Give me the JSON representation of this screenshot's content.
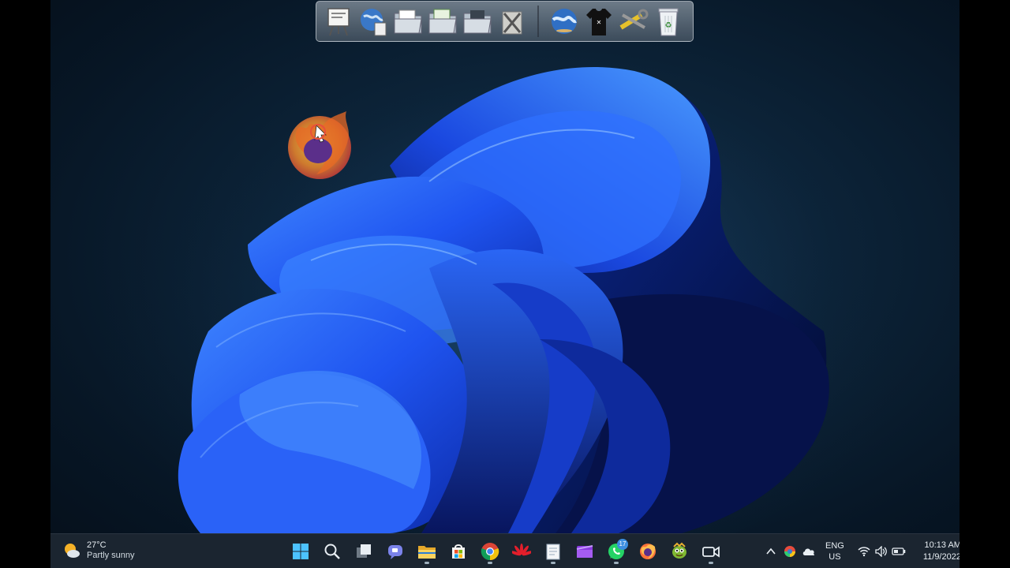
{
  "dock": {
    "items": [
      {
        "name": "presentation-board-icon"
      },
      {
        "name": "globe-document-icon"
      },
      {
        "name": "document-folder-icon"
      },
      {
        "name": "spreadsheet-folder-icon"
      },
      {
        "name": "network-folder-icon"
      },
      {
        "name": "tools-icon"
      },
      {
        "name": "globe-icon"
      },
      {
        "name": "tshirt-icon"
      },
      {
        "name": "wrench-screwdriver-icon"
      },
      {
        "name": "recycle-bin-icon"
      }
    ]
  },
  "desktop": {
    "icons": [
      {
        "name": "firefox-icon"
      }
    ]
  },
  "taskbar": {
    "weather": {
      "temperature": "27°C",
      "condition": "Partly sunny"
    },
    "apps": [
      {
        "name": "start-button",
        "icon": "windows-logo"
      },
      {
        "name": "search-button",
        "icon": "search-icon"
      },
      {
        "name": "task-view-button",
        "icon": "task-view-icon"
      },
      {
        "name": "chat-button",
        "icon": "teams-chat-icon"
      },
      {
        "name": "file-explorer-button",
        "icon": "folder-icon"
      },
      {
        "name": "microsoft-store-button",
        "icon": "store-icon"
      },
      {
        "name": "chrome-button",
        "icon": "chrome-icon"
      },
      {
        "name": "huawei-button",
        "icon": "huawei-icon"
      },
      {
        "name": "notepad-button",
        "icon": "notepad-icon"
      },
      {
        "name": "clipchamp-button",
        "icon": "video-editor-icon"
      },
      {
        "name": "whatsapp-button",
        "icon": "whatsapp-icon",
        "badge": "17"
      },
      {
        "name": "firefox-button",
        "icon": "firefox-icon"
      },
      {
        "name": "game-button",
        "icon": "game-character-icon"
      },
      {
        "name": "camera-button",
        "icon": "video-camera-icon"
      }
    ],
    "tray": {
      "language": {
        "line1": "ENG",
        "line2": "US"
      },
      "clock": {
        "time": "10:13 AM",
        "date": "11/9/2022"
      }
    }
  },
  "colors": {
    "taskbar_bg": "#1b2530",
    "accent_blue": "#2a5ef0",
    "desktop_bg": "#0c2338"
  }
}
